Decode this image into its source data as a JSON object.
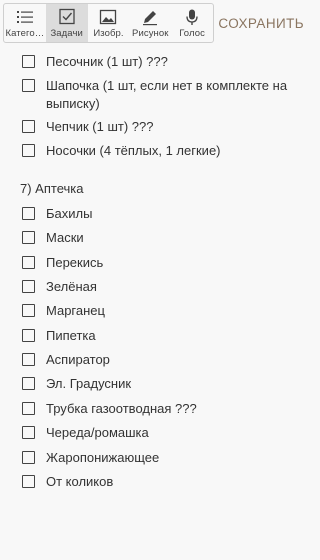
{
  "toolbar": {
    "tools": [
      {
        "label": "Катего…",
        "icon": "list-icon"
      },
      {
        "label": "Задачи",
        "icon": "checkbox-icon",
        "active": true
      },
      {
        "label": "Изобр.",
        "icon": "image-icon"
      },
      {
        "label": "Рисунок",
        "icon": "pen-icon"
      },
      {
        "label": "Голос",
        "icon": "microphone-icon"
      }
    ],
    "save_label": "СОХРАНИТЬ"
  },
  "list": {
    "items_top": [
      "Песочник (1 шт) ???",
      "Шапочка (1 шт, если нет в комплекте на выписку)",
      "Чепчик  (1 шт) ???",
      "Носочки (4 тёплых, 1 легкие)"
    ],
    "section_header": "7) Аптечка",
    "items_bottom": [
      "Бахилы",
      "Маски",
      "Перекись",
      "Зелёная",
      "Марганец",
      "Пипетка",
      "Аспиратор",
      "Эл. Градусник",
      "Трубка газоотводная ???",
      "Череда/ромашка",
      "Жаропонижающее",
      "От коликов"
    ]
  },
  "colors": {
    "accent": "#8a7560",
    "active_tool_bg": "#dcdcdc",
    "background": "#f8f8f8"
  }
}
